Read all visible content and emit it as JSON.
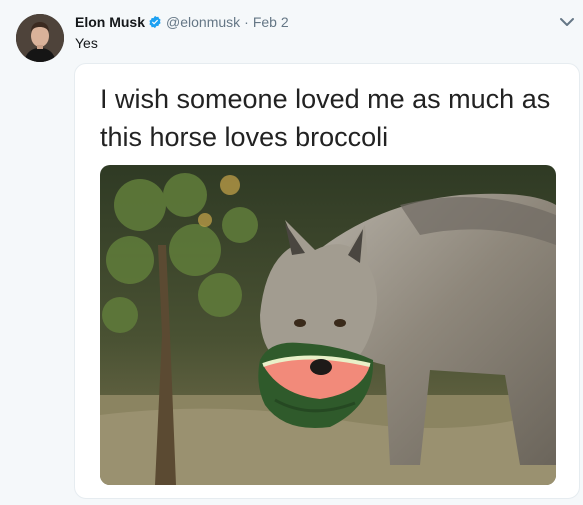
{
  "tweet": {
    "author_name": "Elon Musk",
    "handle": "@elonmusk",
    "separator": "·",
    "date": "Feb 2",
    "text": "Yes",
    "verified": true
  },
  "meme": {
    "caption": "I wish someone loved me as much as this horse loves broccoli"
  },
  "icons": {
    "verified": "verified-badge-icon",
    "menu": "chevron-down-icon"
  },
  "colors": {
    "background": "#f5f8fa",
    "verified_blue": "#1da1f2",
    "secondary_text": "#657786",
    "primary_text": "#14171a"
  }
}
